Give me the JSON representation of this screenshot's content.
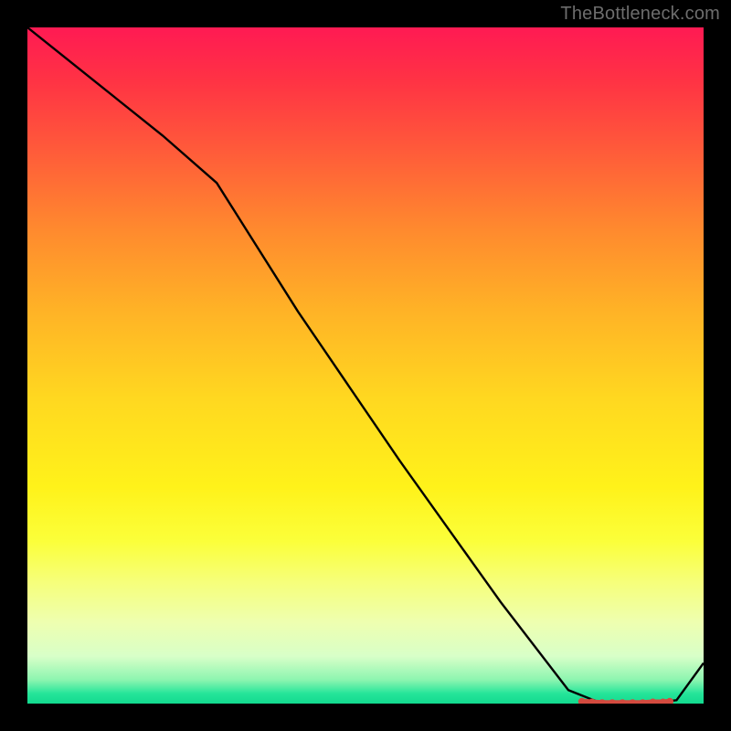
{
  "watermark": "TheBottleneck.com",
  "chart_data": {
    "type": "line",
    "title": "",
    "xlabel": "",
    "ylabel": "",
    "xlim": [
      0,
      100
    ],
    "ylim": [
      0,
      100
    ],
    "grid": false,
    "legend": false,
    "series": [
      {
        "name": "curve",
        "color": "#000000",
        "x": [
          0,
          10,
          20,
          28,
          40,
          55,
          70,
          80,
          85,
          88,
          92,
          96,
          100
        ],
        "y": [
          100,
          92,
          84,
          77,
          58,
          36,
          15,
          2,
          0,
          0,
          0,
          0.5,
          6
        ]
      }
    ],
    "markers": {
      "name": "highlight-band",
      "color": "#d44a3f",
      "x": [
        82,
        83.5,
        85,
        86.5,
        88,
        89.5,
        91,
        92.5,
        94,
        95
      ],
      "y": [
        0.3,
        0.2,
        0.1,
        0.1,
        0.1,
        0.1,
        0.1,
        0.2,
        0.2,
        0.3
      ]
    }
  }
}
